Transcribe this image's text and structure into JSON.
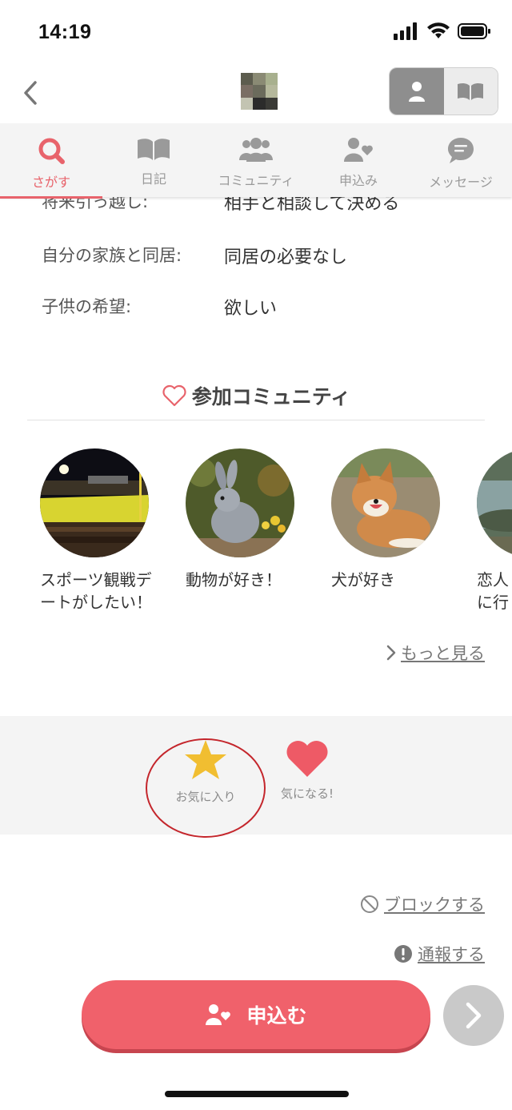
{
  "status_bar": {
    "time": "14:19"
  },
  "nav": {
    "tabs": [
      {
        "label": "さがす",
        "icon": "search-icon",
        "active": true
      },
      {
        "label": "日記",
        "icon": "book-icon",
        "active": false
      },
      {
        "label": "コミュニティ",
        "icon": "group-icon",
        "active": false
      },
      {
        "label": "申込み",
        "icon": "user-heart-icon",
        "active": false
      },
      {
        "label": "メッセージ",
        "icon": "chat-icon",
        "active": false
      }
    ]
  },
  "profile": {
    "rows": [
      {
        "label": "将来引っ越し:",
        "value": "相手と相談して決める"
      },
      {
        "label": "自分の家族と同居:",
        "value": "同居の必要なし"
      },
      {
        "label": "子供の希望:",
        "value": "欲しい"
      }
    ]
  },
  "communities": {
    "title": "参加コミュニティ",
    "items": [
      {
        "name": "スポーツ観戦デートがしたい！",
        "image": "stadium"
      },
      {
        "name": "動物が好き！",
        "image": "rabbit"
      },
      {
        "name": "犬が好き",
        "image": "dog"
      },
      {
        "name": "恋人と…に行…",
        "image": "river"
      }
    ],
    "more_label": "もっと見る"
  },
  "actions": {
    "favorite_label": "お気に入り",
    "like_label": "気になる!"
  },
  "links": {
    "block_label": "ブロックする",
    "report_label": "通報する"
  },
  "apply": {
    "label": "申込む"
  },
  "colors": {
    "accent": "#e8636b",
    "star": "#f1be31",
    "heart": "#ee5a66",
    "button": "#f0616b"
  }
}
